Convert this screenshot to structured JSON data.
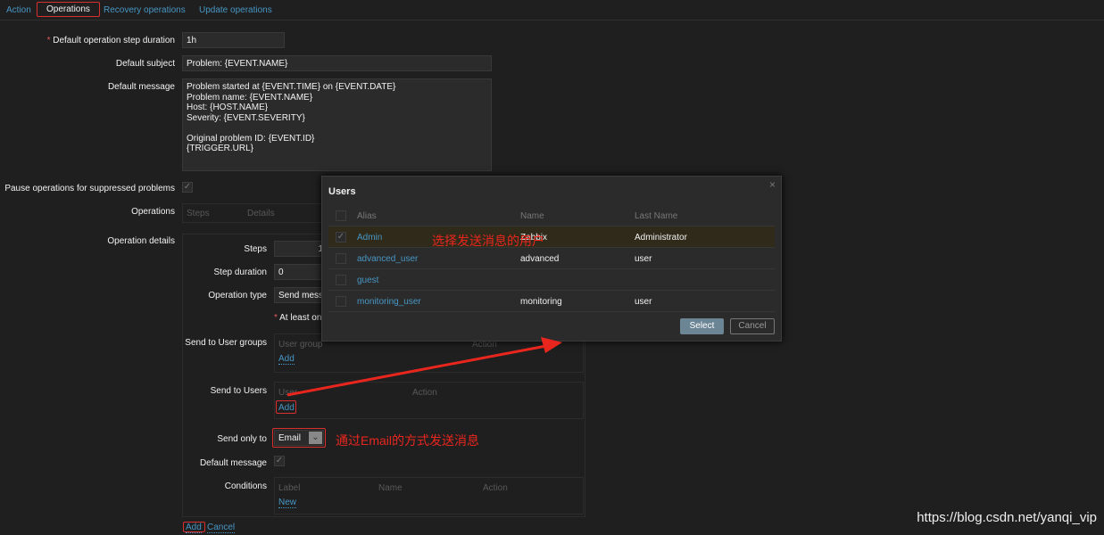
{
  "tabs": [
    {
      "label": "Action"
    },
    {
      "label": "Operations"
    },
    {
      "label": "Recovery operations"
    },
    {
      "label": "Update operations"
    }
  ],
  "form": {
    "step_duration_label": "Default operation step duration",
    "step_duration_value": "1h",
    "subject_label": "Default subject",
    "subject_value": "Problem: {EVENT.NAME}",
    "message_label": "Default message",
    "message_value": "Problem started at {EVENT.TIME} on {EVENT.DATE}\nProblem name: {EVENT.NAME}\nHost: {HOST.NAME}\nSeverity: {EVENT.SEVERITY}\n\nOriginal problem ID: {EVENT.ID}\n{TRIGGER.URL}",
    "pause_label": "Pause operations for suppressed problems",
    "pause_checked": true,
    "operations_label": "Operations",
    "operations_headers": [
      "Steps",
      "Details"
    ],
    "details_label": "Operation details"
  },
  "details": {
    "steps_label": "Steps",
    "steps_value": "1",
    "step_duration_label": "Step duration",
    "step_duration_value": "0",
    "op_type_label": "Operation type",
    "op_type_value": "Send message",
    "at_least": "At least one user or user group must be selected.",
    "user_groups_label": "Send to User groups",
    "user_groups_headers": [
      "User group",
      "Action"
    ],
    "user_groups_add": "Add",
    "users_label": "Send to Users",
    "users_headers": [
      "User",
      "Action"
    ],
    "users_add": "Add",
    "send_only_label": "Send only to",
    "send_only_value": "Email",
    "default_message_label": "Default message",
    "default_message_checked": true,
    "conditions_label": "Conditions",
    "conditions_headers": [
      "Label",
      "Name",
      "Action"
    ],
    "conditions_new": "New",
    "add": "Add",
    "cancel": "Cancel"
  },
  "dialog": {
    "title": "Users",
    "close": "×",
    "headers": [
      "Alias",
      "Name",
      "Last Name"
    ],
    "rows": [
      {
        "alias": "Admin",
        "name": "Zabbix",
        "last": "Administrator",
        "checked": true
      },
      {
        "alias": "advanced_user",
        "name": "advanced",
        "last": "user",
        "checked": false
      },
      {
        "alias": "guest",
        "name": "",
        "last": "",
        "checked": false
      },
      {
        "alias": "monitoring_user",
        "name": "monitoring",
        "last": "user",
        "checked": false
      }
    ],
    "select": "Select",
    "cancel": "Cancel"
  },
  "annotations": {
    "select_user": "选择发送消息的用户",
    "via_email": "通过Email的方式发送消息"
  },
  "watermark": "https://blog.csdn.net/yanqi_vip",
  "colors": {
    "background": "#1f1f1f",
    "link": "#4796c4",
    "annotation": "#e8261e",
    "selected_row": "#2f2a1a"
  }
}
